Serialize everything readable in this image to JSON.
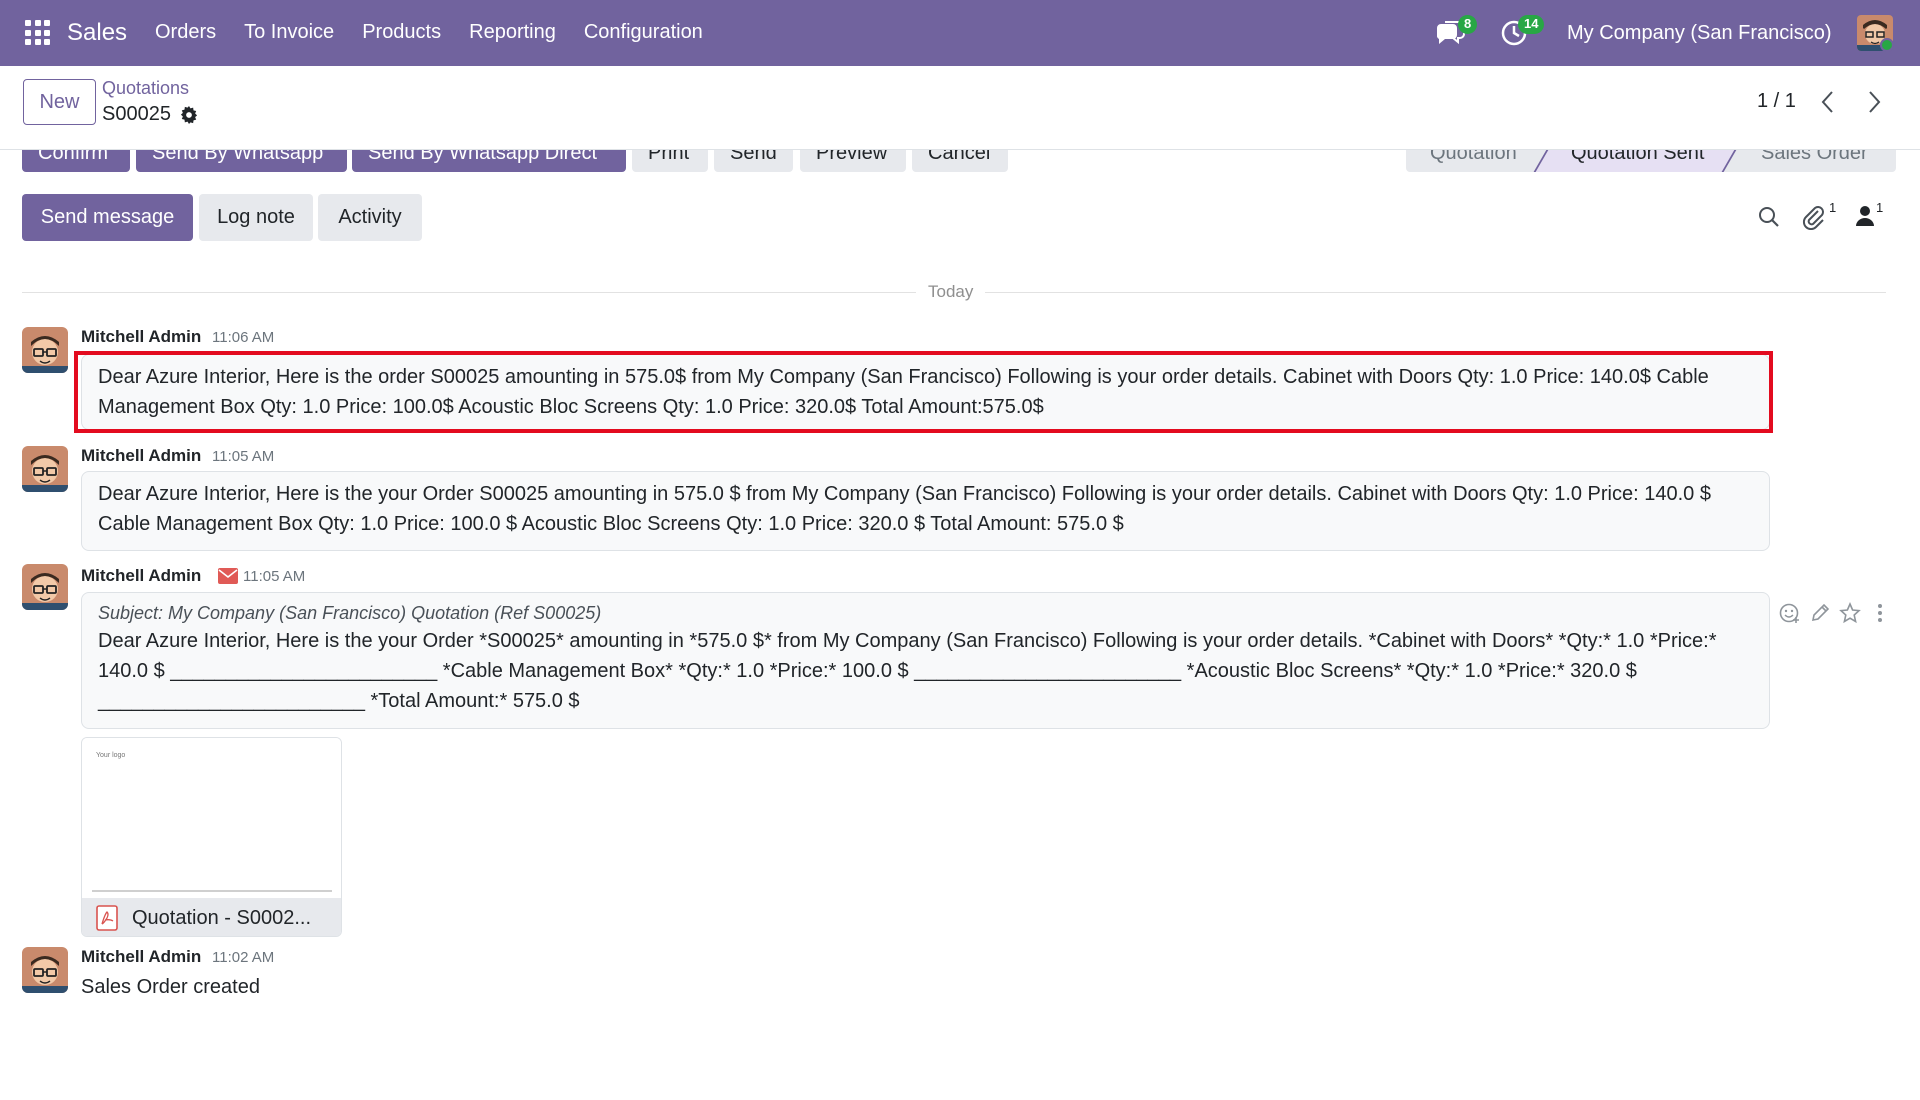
{
  "navbar": {
    "app_name": "Sales",
    "menu": [
      "Orders",
      "To Invoice",
      "Products",
      "Reporting",
      "Configuration"
    ],
    "messages_count": "8",
    "activities_count": "14",
    "company": "My Company (San Francisco)"
  },
  "control_panel": {
    "new_label": "New",
    "breadcrumb_parent": "Quotations",
    "record_name": "S00025",
    "pager": "1 / 1"
  },
  "statusbar": {
    "buttons": [
      "Confirm",
      "Send By Whatsapp",
      "Send By Whatsapp Direct",
      "Print",
      "Send",
      "Preview",
      "Cancel"
    ],
    "stages": [
      "Quotation",
      "Quotation Sent",
      "Sales Order"
    ],
    "active_stage": "Quotation Sent"
  },
  "chatter": {
    "send_message": "Send message",
    "log_note": "Log note",
    "activity": "Activity",
    "attachments_count": "1",
    "followers_count": "1",
    "date_separator": "Today",
    "messages": [
      {
        "author": "Mitchell Admin",
        "time": "11:06 AM",
        "body": "Dear Azure Interior, Here is the order S00025 amounting in 575.0$ from My Company (San Francisco) Following is your order details. Cabinet with Doors Qty: 1.0 Price: 140.0$ Cable Management Box Qty: 1.0 Price: 100.0$ Acoustic Bloc Screens Qty: 1.0 Price: 320.0$ Total Amount:575.0$"
      },
      {
        "author": "Mitchell Admin",
        "time": "11:05 AM",
        "body": "Dear Azure Interior, Here is the your Order S00025 amounting in 575.0 $ from My Company (San Francisco) Following is your order details. Cabinet with Doors Qty: 1.0 Price: 140.0 $ Cable Management Box Qty: 1.0 Price: 100.0 $ Acoustic Bloc Screens Qty: 1.0 Price: 320.0 $ Total Amount: 575.0 $"
      },
      {
        "author": "Mitchell Admin",
        "time": "11:05 AM",
        "subject": "Subject: My Company (San Francisco) Quotation (Ref S00025)",
        "body": "Dear Azure Interior, Here is the your Order *S00025* amounting in *575.0 $* from My Company (San Francisco) Following is your order details. *Cabinet with Doors* *Qty:* 1.0 *Price:* 140.0 $ ________________________ *Cable Management Box* *Qty:* 1.0 *Price:* 100.0 $ ________________________ *Acoustic Bloc Screens* *Qty:* 1.0 *Price:* 320.0 $ ________________________ *Total Amount:* 575.0 $",
        "attachment_preview_text": "Your logo",
        "attachment_name": "Quotation - S0002..."
      },
      {
        "author": "Mitchell Admin",
        "time": "11:02 AM",
        "body": "Sales Order created"
      }
    ]
  },
  "colors": {
    "brand": "#71639e",
    "badge": "#28a745",
    "highlight": "#e30b1f"
  }
}
